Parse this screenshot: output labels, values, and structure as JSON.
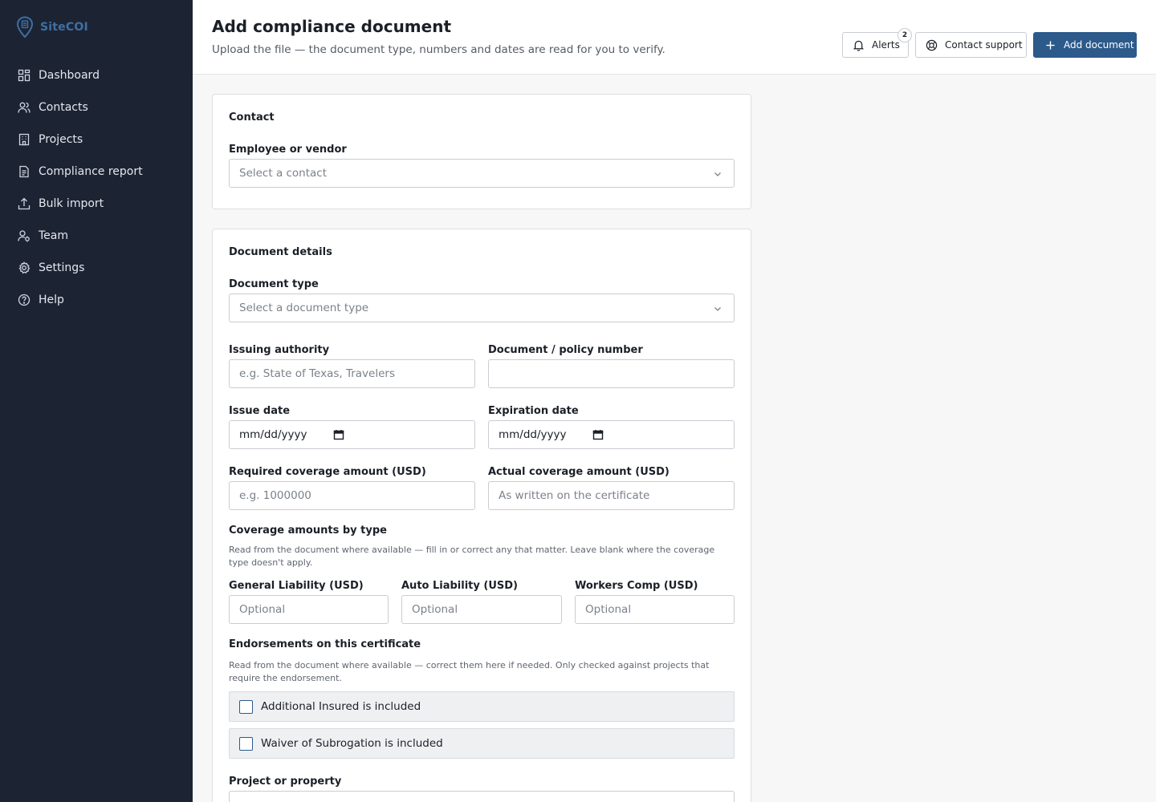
{
  "brand": {
    "name": "SiteCOI",
    "accent": "#3f6fa2"
  },
  "sidebar": {
    "items": [
      {
        "label": "Dashboard",
        "icon": "dashboard-grid-icon"
      },
      {
        "label": "Contacts",
        "icon": "contacts-icon"
      },
      {
        "label": "Projects",
        "icon": "building-icon"
      },
      {
        "label": "Compliance report",
        "icon": "document-report-icon"
      },
      {
        "label": "Bulk import",
        "icon": "upload-icon"
      },
      {
        "label": "Team",
        "icon": "team-icon"
      },
      {
        "label": "Settings",
        "icon": "gear-icon"
      },
      {
        "label": "Help",
        "icon": "help-circle-icon"
      }
    ]
  },
  "header": {
    "title": "Add compliance document",
    "subtitle": "Upload the file — the document type, numbers and dates are read for you to verify.",
    "alerts_label": "Alerts",
    "alerts_count": "2",
    "support_label": "Contact support",
    "add_label": "Add document",
    "primary_color": "#2c5a8a"
  },
  "contact_card": {
    "title": "Contact",
    "contact_label": "Employee or vendor",
    "contact_placeholder": "Select a contact"
  },
  "details_card": {
    "title": "Document details",
    "doc_type_label": "Document type",
    "doc_type_placeholder": "Select a document type",
    "authority_label": "Issuing authority",
    "authority_placeholder": "e.g. State of Texas, Travelers",
    "number_label": "Document / policy number",
    "number_value": "",
    "issue_label": "Issue date",
    "issue_value": "mm/dd/yyyy",
    "expiration_label": "Expiration date",
    "expiration_value": "mm/dd/yyyy",
    "required_label": "Required coverage amount (USD)",
    "required_placeholder": "e.g. 1000000",
    "actual_label": "Actual coverage amount (USD)",
    "actual_placeholder": "As written on the certificate",
    "coverage_title": "Coverage amounts by type",
    "coverage_help": "Read from the document where available — fill in or correct any that matter. Leave blank where the coverage type doesn't apply.",
    "gl_label": "General Liability (USD)",
    "auto_label": "Auto Liability (USD)",
    "wc_label": "Workers Comp (USD)",
    "optional_placeholder": "Optional",
    "endorsements_title": "Endorsements on this certificate",
    "endorsements_help": "Read from the document where available — correct them here if needed. Only checked against projects that require the endorsement.",
    "additional_insured_label": "Additional Insured is included",
    "waiver_label": "Waiver of Subrogation is included",
    "project_label": "Project or property"
  }
}
